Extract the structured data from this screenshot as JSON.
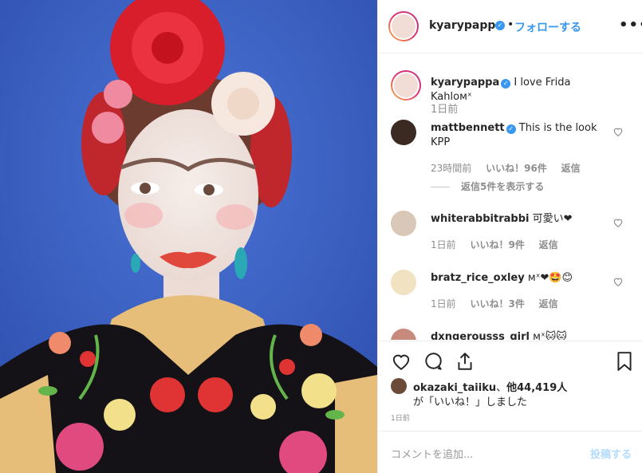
{
  "post": {
    "author": "kyarypappa",
    "follow_label": "フォローする",
    "separator": "•",
    "more_label": "•••"
  },
  "caption": {
    "author": "kyarypappa",
    "text": "I love Frida Kahloᴍˣ",
    "time": "1日前"
  },
  "comments": [
    {
      "author": "mattbennett",
      "text": "This is the look KPP",
      "time": "23時間前",
      "likes": "いいね！96件",
      "reply": "返信",
      "view_replies": "返信5件を表示する"
    },
    {
      "author": "whiterabbitrabbi",
      "text": "可愛い❤",
      "time": "1日前",
      "likes": "いいね！9件",
      "reply": "返信"
    },
    {
      "author": "bratz_rice_oxley",
      "text": "ᴍˣ❤🤩😊",
      "time": "1日前",
      "likes": "いいね！3件",
      "reply": "返信"
    },
    {
      "author": "dxngerousss_girl",
      "text": "ᴍˣ🐱🐱",
      "time": "",
      "likes": "",
      "reply": ""
    }
  ],
  "likes": {
    "user": "okazaki_taiiku",
    "sep": "、",
    "others": "他44,419人",
    "suffix": "が「いいね！」しました"
  },
  "post_time": "1日前",
  "add_comment": {
    "placeholder": "コメントを追加...",
    "post_label": "投稿する"
  },
  "colors": {
    "accent": "#3897f0",
    "post_disabled": "#b3dbff",
    "background_wall": "#3b63c4",
    "rose_red": "#d81e2a"
  }
}
